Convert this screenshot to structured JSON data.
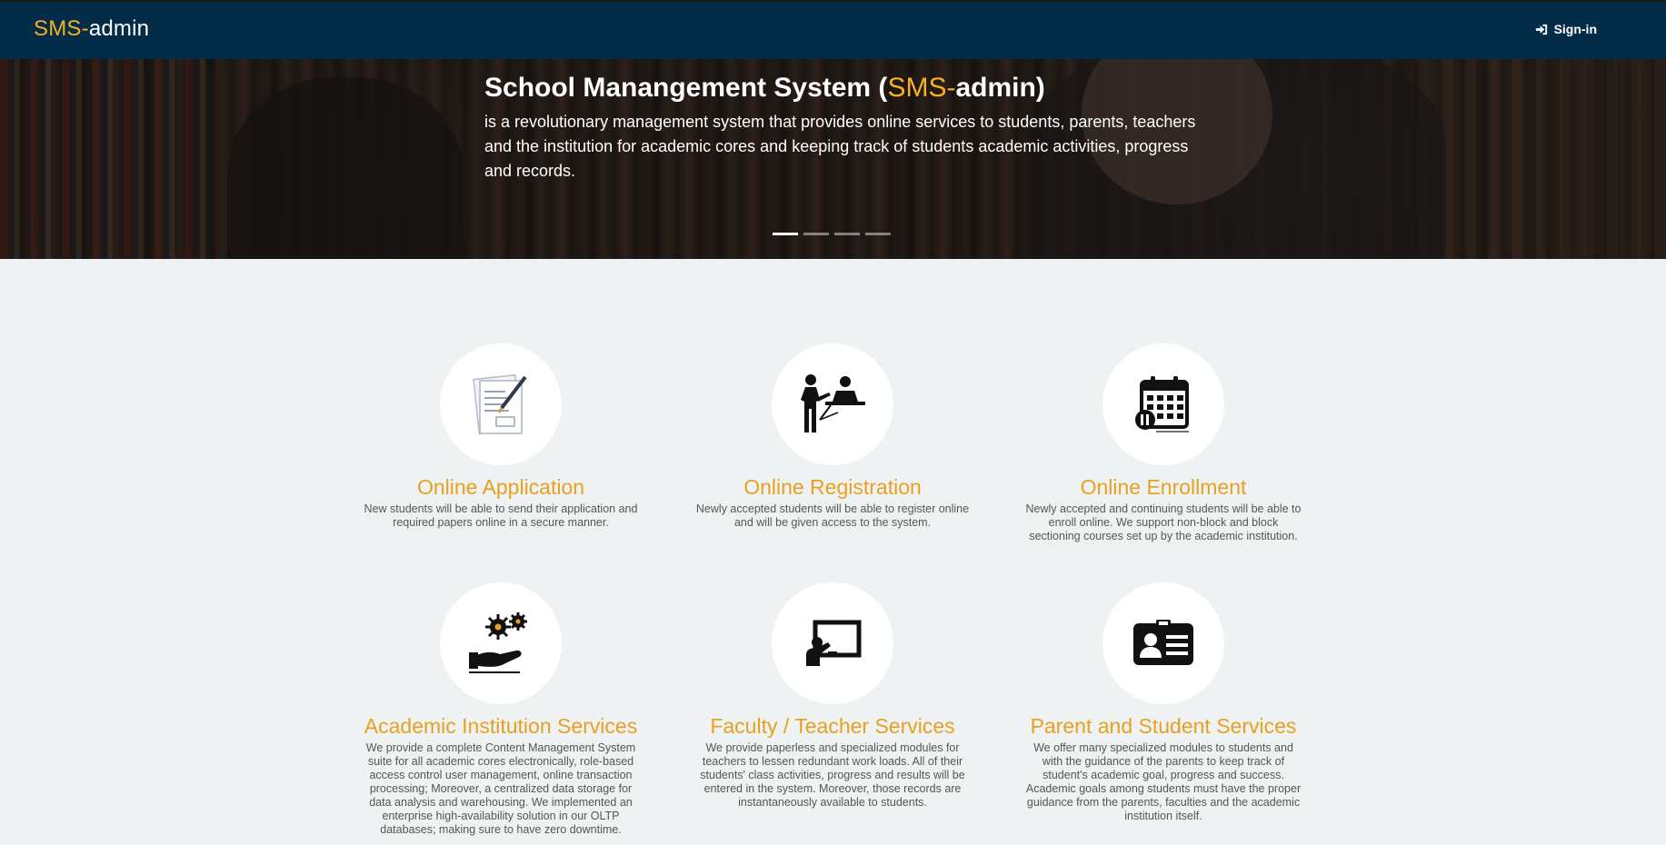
{
  "nav": {
    "brand_accent": "SMS-",
    "brand_rest": "admin",
    "signin_label": "Sign-in",
    "signin_icon": "sign-in-icon"
  },
  "hero": {
    "title_pre": "School Manangement System (",
    "title_accent": "SMS-",
    "title_mid": "admin",
    "title_post": ")",
    "description": "is a revolutionary management system that provides online services to students, parents, teachers and the institution for academic cores and keeping track of students academic activities, progress and records.",
    "slides": 4,
    "active_slide": 1
  },
  "features": [
    {
      "icon": "application-form-icon",
      "title": "Online Application",
      "text": "New students will be able to send their application and required papers online in a secure manner."
    },
    {
      "icon": "registration-icon",
      "title": "Online Registration",
      "text": "Newly accepted students will be able to register online and will be given access to the system."
    },
    {
      "icon": "calendar-icon",
      "title": "Online Enrollment",
      "text": "Newly accepted and continuing students will be able to enroll online. We support non-block and block sectioning courses set up by the academic institution."
    },
    {
      "icon": "institution-services-icon",
      "title": "Academic Institution Services",
      "text": "We provide a complete Content Management System suite for all academic cores electronically, role-based access control user management, online transaction processing; Moreover, a centralized data storage for data analysis and warehousing. We implemented an enterprise high-availability solution in our OLTP databases; making sure to have zero downtime."
    },
    {
      "icon": "teacher-board-icon",
      "title": "Faculty / Teacher Services",
      "text": "We provide paperless and specialized modules for teachers to lessen redundant work loads. All of their students' class activities, progress and results will be entered in the system. Moreover, those records are instantaneously available to students."
    },
    {
      "icon": "id-card-icon",
      "title": "Parent and Student Services",
      "text": "We offer many specialized modules to students and with the guidance of the parents to keep track of student's academic goal, progress and success. Academic goals among students must have the proper guidance from the parents, faculties and the academic institution itself."
    }
  ],
  "colors": {
    "nav_bg": "#032c49",
    "accent": "#f5b024",
    "feature_title": "#e8a020",
    "page_bg": "#eff2f3"
  }
}
